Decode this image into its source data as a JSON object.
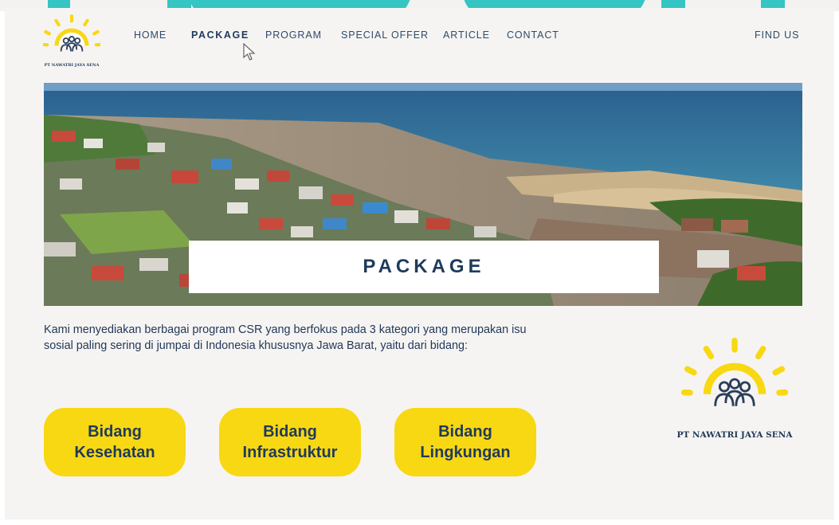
{
  "brand": {
    "name": "PT NAWATRI JAYA SENA",
    "sun_color": "#f8d812",
    "navy_color": "#1f3a5c"
  },
  "nav": {
    "items": [
      {
        "label": "HOME",
        "active": false
      },
      {
        "label": "PACKAGE",
        "active": true
      },
      {
        "label": "PROGRAM",
        "active": false
      },
      {
        "label": "SPECIAL OFFER",
        "active": false
      },
      {
        "label": "ARTICLE",
        "active": false
      },
      {
        "label": "CONTACT",
        "active": false
      }
    ],
    "find_us": "FIND US"
  },
  "hero": {
    "title": "PACKAGE",
    "image": "aerial coastal village photo"
  },
  "intro": {
    "text": "Kami menyediakan berbagai program CSR yang berfokus pada 3 kategori yang merupakan isu sosial paling sering di jumpai di Indonesia khususnya Jawa Barat, yaitu dari bidang:"
  },
  "categories": [
    {
      "label": "Bidang\nKesehatan"
    },
    {
      "label": "Bidang\nInfrastruktur"
    },
    {
      "label": "Bidang\nLingkungan"
    }
  ],
  "icons": {
    "logo": "sun-people-logo-icon",
    "cursor": "mouse-pointer-icon"
  }
}
